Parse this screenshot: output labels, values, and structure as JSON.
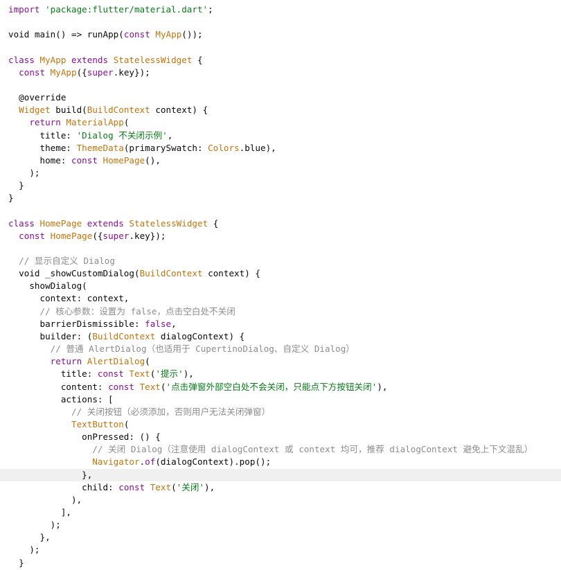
{
  "colors": {
    "background": "#ffffff",
    "keyword": "#0033b3",
    "keyword_purple": "#871094",
    "class_name": "#c0750c",
    "string": "#067d17",
    "comment": "#8c8c8c",
    "annotation": "#9e880d",
    "plain": "#080808",
    "current_line": "#f0f0f0"
  },
  "editor": {
    "highlighted_line": 38,
    "lines": [
      [
        {
          "t": "import ",
          "c": "kw2"
        },
        {
          "t": "'package:flutter/material.dart'",
          "c": "str"
        },
        {
          "t": ";",
          "c": "plain"
        }
      ],
      [],
      [
        {
          "t": "void ",
          "c": "plain"
        },
        {
          "t": "main",
          "c": "plain"
        },
        {
          "t": "() => ",
          "c": "plain"
        },
        {
          "t": "runApp",
          "c": "plain"
        },
        {
          "t": "(",
          "c": "plain"
        },
        {
          "t": "const ",
          "c": "kw2"
        },
        {
          "t": "MyApp",
          "c": "cls"
        },
        {
          "t": "());",
          "c": "plain"
        }
      ],
      [],
      [
        {
          "t": "class ",
          "c": "kw2"
        },
        {
          "t": "MyApp ",
          "c": "cls"
        },
        {
          "t": "extends ",
          "c": "kw2"
        },
        {
          "t": "StatelessWidget",
          "c": "cls"
        },
        {
          "t": " {",
          "c": "plain"
        }
      ],
      [
        {
          "t": "  ",
          "c": "plain"
        },
        {
          "t": "const ",
          "c": "kw2"
        },
        {
          "t": "MyApp",
          "c": "cls"
        },
        {
          "t": "({",
          "c": "plain"
        },
        {
          "t": "super",
          "c": "kw2"
        },
        {
          "t": ".key});",
          "c": "plain"
        }
      ],
      [],
      [
        {
          "t": "  @override",
          "c": "plain"
        }
      ],
      [
        {
          "t": "  ",
          "c": "plain"
        },
        {
          "t": "Widget ",
          "c": "cls"
        },
        {
          "t": "build(",
          "c": "plain"
        },
        {
          "t": "BuildContext ",
          "c": "cls"
        },
        {
          "t": "context) {",
          "c": "plain"
        }
      ],
      [
        {
          "t": "    ",
          "c": "plain"
        },
        {
          "t": "return ",
          "c": "kw2"
        },
        {
          "t": "MaterialApp",
          "c": "cls"
        },
        {
          "t": "(",
          "c": "plain"
        }
      ],
      [
        {
          "t": "      title: ",
          "c": "plain"
        },
        {
          "t": "'Dialog 不关闭示例'",
          "c": "str"
        },
        {
          "t": ",",
          "c": "plain"
        }
      ],
      [
        {
          "t": "      theme: ",
          "c": "plain"
        },
        {
          "t": "ThemeData",
          "c": "cls"
        },
        {
          "t": "(primarySwatch: ",
          "c": "plain"
        },
        {
          "t": "Colors",
          "c": "cls"
        },
        {
          "t": ".blue),",
          "c": "plain"
        }
      ],
      [
        {
          "t": "      home: ",
          "c": "plain"
        },
        {
          "t": "const ",
          "c": "kw2"
        },
        {
          "t": "HomePage",
          "c": "cls"
        },
        {
          "t": "(),",
          "c": "plain"
        }
      ],
      [
        {
          "t": "    );",
          "c": "plain"
        }
      ],
      [
        {
          "t": "  }",
          "c": "plain"
        }
      ],
      [
        {
          "t": "}",
          "c": "plain"
        }
      ],
      [],
      [
        {
          "t": "class ",
          "c": "kw2"
        },
        {
          "t": "HomePage ",
          "c": "cls"
        },
        {
          "t": "extends ",
          "c": "kw2"
        },
        {
          "t": "StatelessWidget",
          "c": "cls"
        },
        {
          "t": " {",
          "c": "plain"
        }
      ],
      [
        {
          "t": "  ",
          "c": "plain"
        },
        {
          "t": "const ",
          "c": "kw2"
        },
        {
          "t": "HomePage",
          "c": "cls"
        },
        {
          "t": "({",
          "c": "plain"
        },
        {
          "t": "super",
          "c": "kw2"
        },
        {
          "t": ".key});",
          "c": "plain"
        }
      ],
      [],
      [
        {
          "t": "  // 显示自定义 Dialog",
          "c": "com"
        }
      ],
      [
        {
          "t": "  void _showCustomDialog(",
          "c": "plain"
        },
        {
          "t": "BuildContext ",
          "c": "cls"
        },
        {
          "t": "context) {",
          "c": "plain"
        }
      ],
      [
        {
          "t": "    showDialog(",
          "c": "plain"
        }
      ],
      [
        {
          "t": "      context: context,",
          "c": "plain"
        }
      ],
      [
        {
          "t": "      // 核心参数：设置为 false，点击空白处不关闭",
          "c": "com"
        }
      ],
      [
        {
          "t": "      barrierDismissible: ",
          "c": "plain"
        },
        {
          "t": "false",
          "c": "kw2"
        },
        {
          "t": ",",
          "c": "plain"
        }
      ],
      [
        {
          "t": "      builder: (",
          "c": "plain"
        },
        {
          "t": "BuildContext ",
          "c": "cls"
        },
        {
          "t": "dialogContext) {",
          "c": "plain"
        }
      ],
      [
        {
          "t": "        // 普通 AlertDialog（也适用于 CupertinoDialog、自定义 Dialog）",
          "c": "com"
        }
      ],
      [
        {
          "t": "        ",
          "c": "plain"
        },
        {
          "t": "return ",
          "c": "kw2"
        },
        {
          "t": "AlertDialog",
          "c": "cls"
        },
        {
          "t": "(",
          "c": "plain"
        }
      ],
      [
        {
          "t": "          title: ",
          "c": "plain"
        },
        {
          "t": "const ",
          "c": "kw2"
        },
        {
          "t": "Text",
          "c": "cls"
        },
        {
          "t": "(",
          "c": "plain"
        },
        {
          "t": "'提示'",
          "c": "str"
        },
        {
          "t": "),",
          "c": "plain"
        }
      ],
      [
        {
          "t": "          content: ",
          "c": "plain"
        },
        {
          "t": "const ",
          "c": "kw2"
        },
        {
          "t": "Text",
          "c": "cls"
        },
        {
          "t": "(",
          "c": "plain"
        },
        {
          "t": "'点击弹窗外部空白处不会关闭，只能点下方按钮关闭'",
          "c": "str"
        },
        {
          "t": "),",
          "c": "plain"
        }
      ],
      [
        {
          "t": "          actions: [",
          "c": "plain"
        }
      ],
      [
        {
          "t": "            // 关闭按钮（必须添加，否则用户无法关闭弹窗）",
          "c": "com"
        }
      ],
      [
        {
          "t": "            ",
          "c": "plain"
        },
        {
          "t": "TextButton",
          "c": "cls"
        },
        {
          "t": "(",
          "c": "plain"
        }
      ],
      [
        {
          "t": "              onPressed: () {",
          "c": "plain"
        }
      ],
      [
        {
          "t": "                // 关闭 Dialog（注意使用 dialogContext 或 context 均可，推荐 dialogContext 避免上下文混乱）",
          "c": "com"
        }
      ],
      [
        {
          "t": "                ",
          "c": "plain"
        },
        {
          "t": "Navigator",
          "c": "cls"
        },
        {
          "t": ".",
          "c": "plain"
        },
        {
          "t": "of",
          "c": "kw2"
        },
        {
          "t": "(dialogContext).pop();",
          "c": "plain"
        }
      ],
      [
        {
          "t": "              },",
          "c": "plain"
        }
      ],
      [
        {
          "t": "              child: ",
          "c": "plain"
        },
        {
          "t": "const ",
          "c": "kw2"
        },
        {
          "t": "Text",
          "c": "cls"
        },
        {
          "t": "(",
          "c": "plain"
        },
        {
          "t": "'关闭'",
          "c": "str"
        },
        {
          "t": "),",
          "c": "plain"
        }
      ],
      [
        {
          "t": "            ),",
          "c": "plain"
        }
      ],
      [
        {
          "t": "          ],",
          "c": "plain"
        }
      ],
      [
        {
          "t": "        );",
          "c": "plain"
        }
      ],
      [
        {
          "t": "      },",
          "c": "plain"
        }
      ],
      [
        {
          "t": "    );",
          "c": "plain"
        }
      ],
      [
        {
          "t": "  }",
          "c": "plain"
        }
      ]
    ]
  }
}
